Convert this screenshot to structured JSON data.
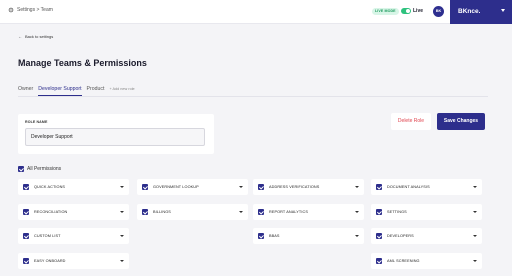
{
  "header": {
    "breadcrumb": "Settings > Team",
    "live_badge": "LIVE MODE",
    "live_label": "Live",
    "avatar_initials": "BK",
    "brand": "BKnce."
  },
  "back_link": "Back to settings",
  "page_title": "Manage Teams & Permissions",
  "tabs": [
    {
      "label": "Owner"
    },
    {
      "label": "Developer Support"
    },
    {
      "label": "Product"
    },
    {
      "label": "+ Add new role"
    }
  ],
  "role": {
    "label": "ROLE NAME",
    "value": "Developer Support"
  },
  "actions": {
    "delete": "Delete Role",
    "save": "Save Changes"
  },
  "all_permissions": "All Permissions",
  "permissions": [
    "QUICK ACTIONS",
    "GOVERNMENT LOOKUP",
    "ADDRESS VERIFICATIONS",
    "DOCUMENT ANALYSIS",
    "RECONCILIATION",
    "BILLINGS",
    "REPORT ANALYTICS",
    "SETTINGS",
    "CUSTOM LIST",
    "BBAS",
    "DEVELOPERS",
    "EASY ONBOARD",
    "AML SCREENING"
  ],
  "colors": {
    "brand": "#2d2e8c",
    "danger": "#e0444f",
    "live": "#2ec27e"
  }
}
